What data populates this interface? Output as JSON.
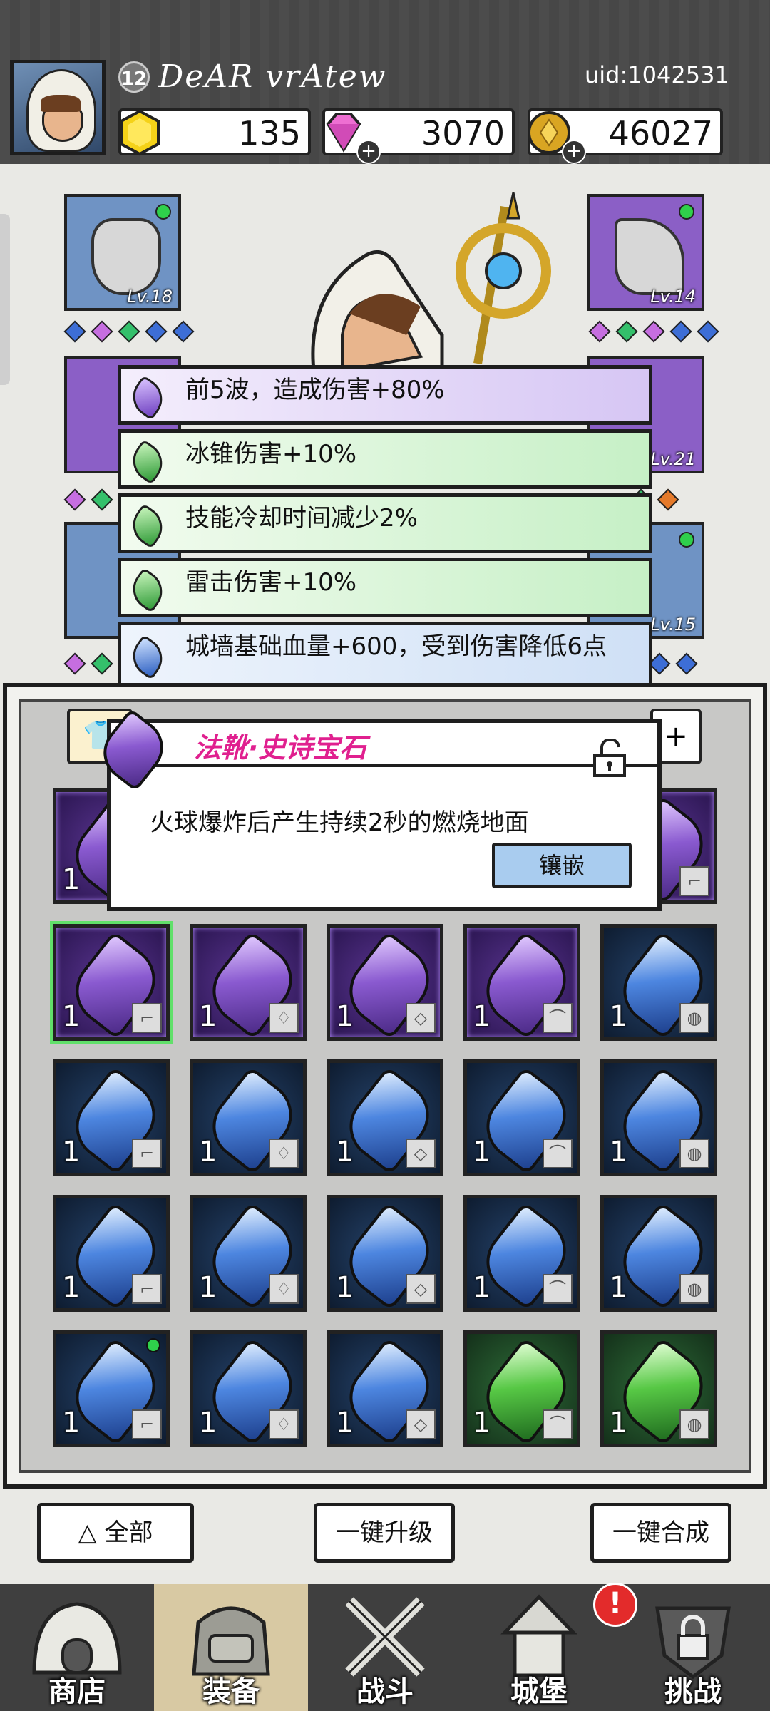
{
  "header": {
    "level": "12",
    "player_name": "DeAR vrAtew",
    "uid": "uid:1042531",
    "resources": [
      {
        "icon": "gold-hex-icon",
        "value": "135"
      },
      {
        "icon": "gem-icon",
        "value": "3070",
        "plus": "+"
      },
      {
        "icon": "coin-icon",
        "value": "46027",
        "plus": "+"
      }
    ]
  },
  "equipment": {
    "slots": [
      {
        "level": "Lv.18",
        "side": "left"
      },
      {
        "level": "Lv.14",
        "side": "right"
      },
      {
        "level": "Lv.21",
        "side": "right"
      },
      {
        "level": "Lv.15",
        "side": "right"
      }
    ]
  },
  "buffs": [
    {
      "text": "前5波，造成伤害+80%",
      "gem": "purple"
    },
    {
      "text": "冰锥伤害+10%",
      "gem": "green"
    },
    {
      "text": "技能冷却时间减少2%",
      "gem": "green"
    },
    {
      "text": "雷击伤害+10%",
      "gem": "green"
    },
    {
      "text": "城墙基础血量+600，受到伤害降低6点",
      "gem": "blue"
    }
  ],
  "popup": {
    "title": "法靴·史诗宝石",
    "description": "火球爆炸后产生持续2秒的燃烧地面",
    "button_label": "镶嵌"
  },
  "inventory": {
    "count_label": "1",
    "rows": [
      [
        "purple",
        "purple",
        "purple",
        "purple",
        "blue"
      ],
      [
        "blue",
        "blue",
        "blue",
        "blue",
        "blue"
      ],
      [
        "blue",
        "blue",
        "blue",
        "blue",
        "blue"
      ],
      [
        "blue",
        "blue",
        "blue",
        "green",
        "green"
      ]
    ]
  },
  "actions": {
    "filter_label": "全部",
    "upgrade_label": "一键升级",
    "merge_label": "一键合成"
  },
  "nav": {
    "items": [
      "商店",
      "装备",
      "战斗",
      "城堡",
      "挑战"
    ],
    "active": "装备",
    "alert": "!"
  }
}
